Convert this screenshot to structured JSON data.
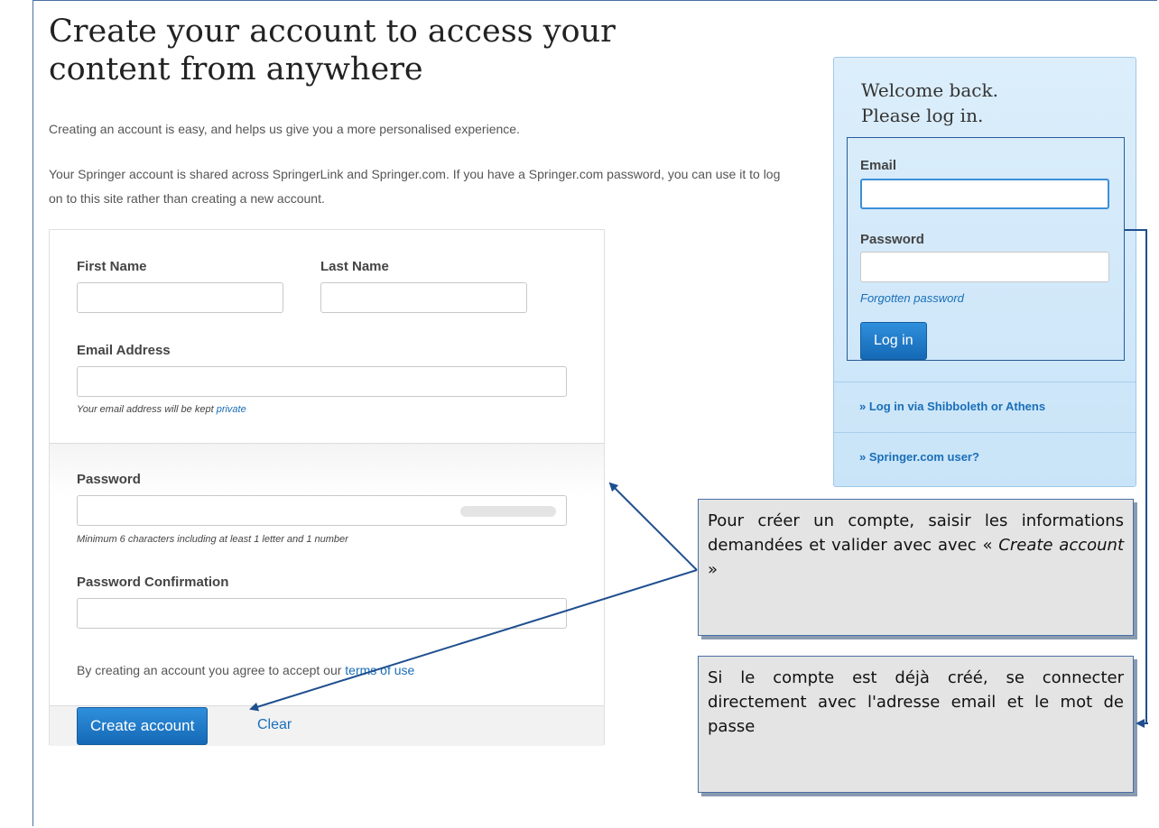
{
  "page": {
    "headline": "Create your account to access your content from anywhere",
    "intro1": "Creating an account is easy, and helps us give you a more personalised experience.",
    "intro2": "Your Springer account is shared across SpringerLink and Springer.com. If you have a Springer.com password, you can use it to log on to this site rather than creating a new account."
  },
  "register": {
    "first_name_label": "First Name",
    "first_name_value": "",
    "last_name_label": "Last Name",
    "last_name_value": "",
    "email_label": "Email Address",
    "email_value": "",
    "email_hint": "Your email address will be kept",
    "email_hint_link": "private",
    "password_label": "Password",
    "password_value": "",
    "password_hint": "Minimum 6 characters including at least 1 letter and 1 number",
    "password_confirm_label": "Password Confirmation",
    "password_confirm_value": "",
    "terms_text": "By creating an account you agree to accept our",
    "terms_link": "terms of use",
    "create_button": "Create account",
    "clear_link": "Clear"
  },
  "login": {
    "title_line1": "Welcome back.",
    "title_line2": "Please log in.",
    "email_label": "Email",
    "email_value": "",
    "password_label": "Password",
    "password_value": "",
    "forgot_link": "Forgotten password",
    "login_button": "Log in",
    "shibboleth_link": "» Log in via Shibboleth or Athens",
    "springer_link": "» Springer.com user?"
  },
  "callouts": {
    "create_text": "Pour créer un compte, saisir les informations demandées et valider avec avec «",
    "create_em": "Create account",
    "create_end": "»",
    "login_text": "Si le compte est déjà créé, se connecter directement avec l'adresse email et le mot de passe"
  }
}
